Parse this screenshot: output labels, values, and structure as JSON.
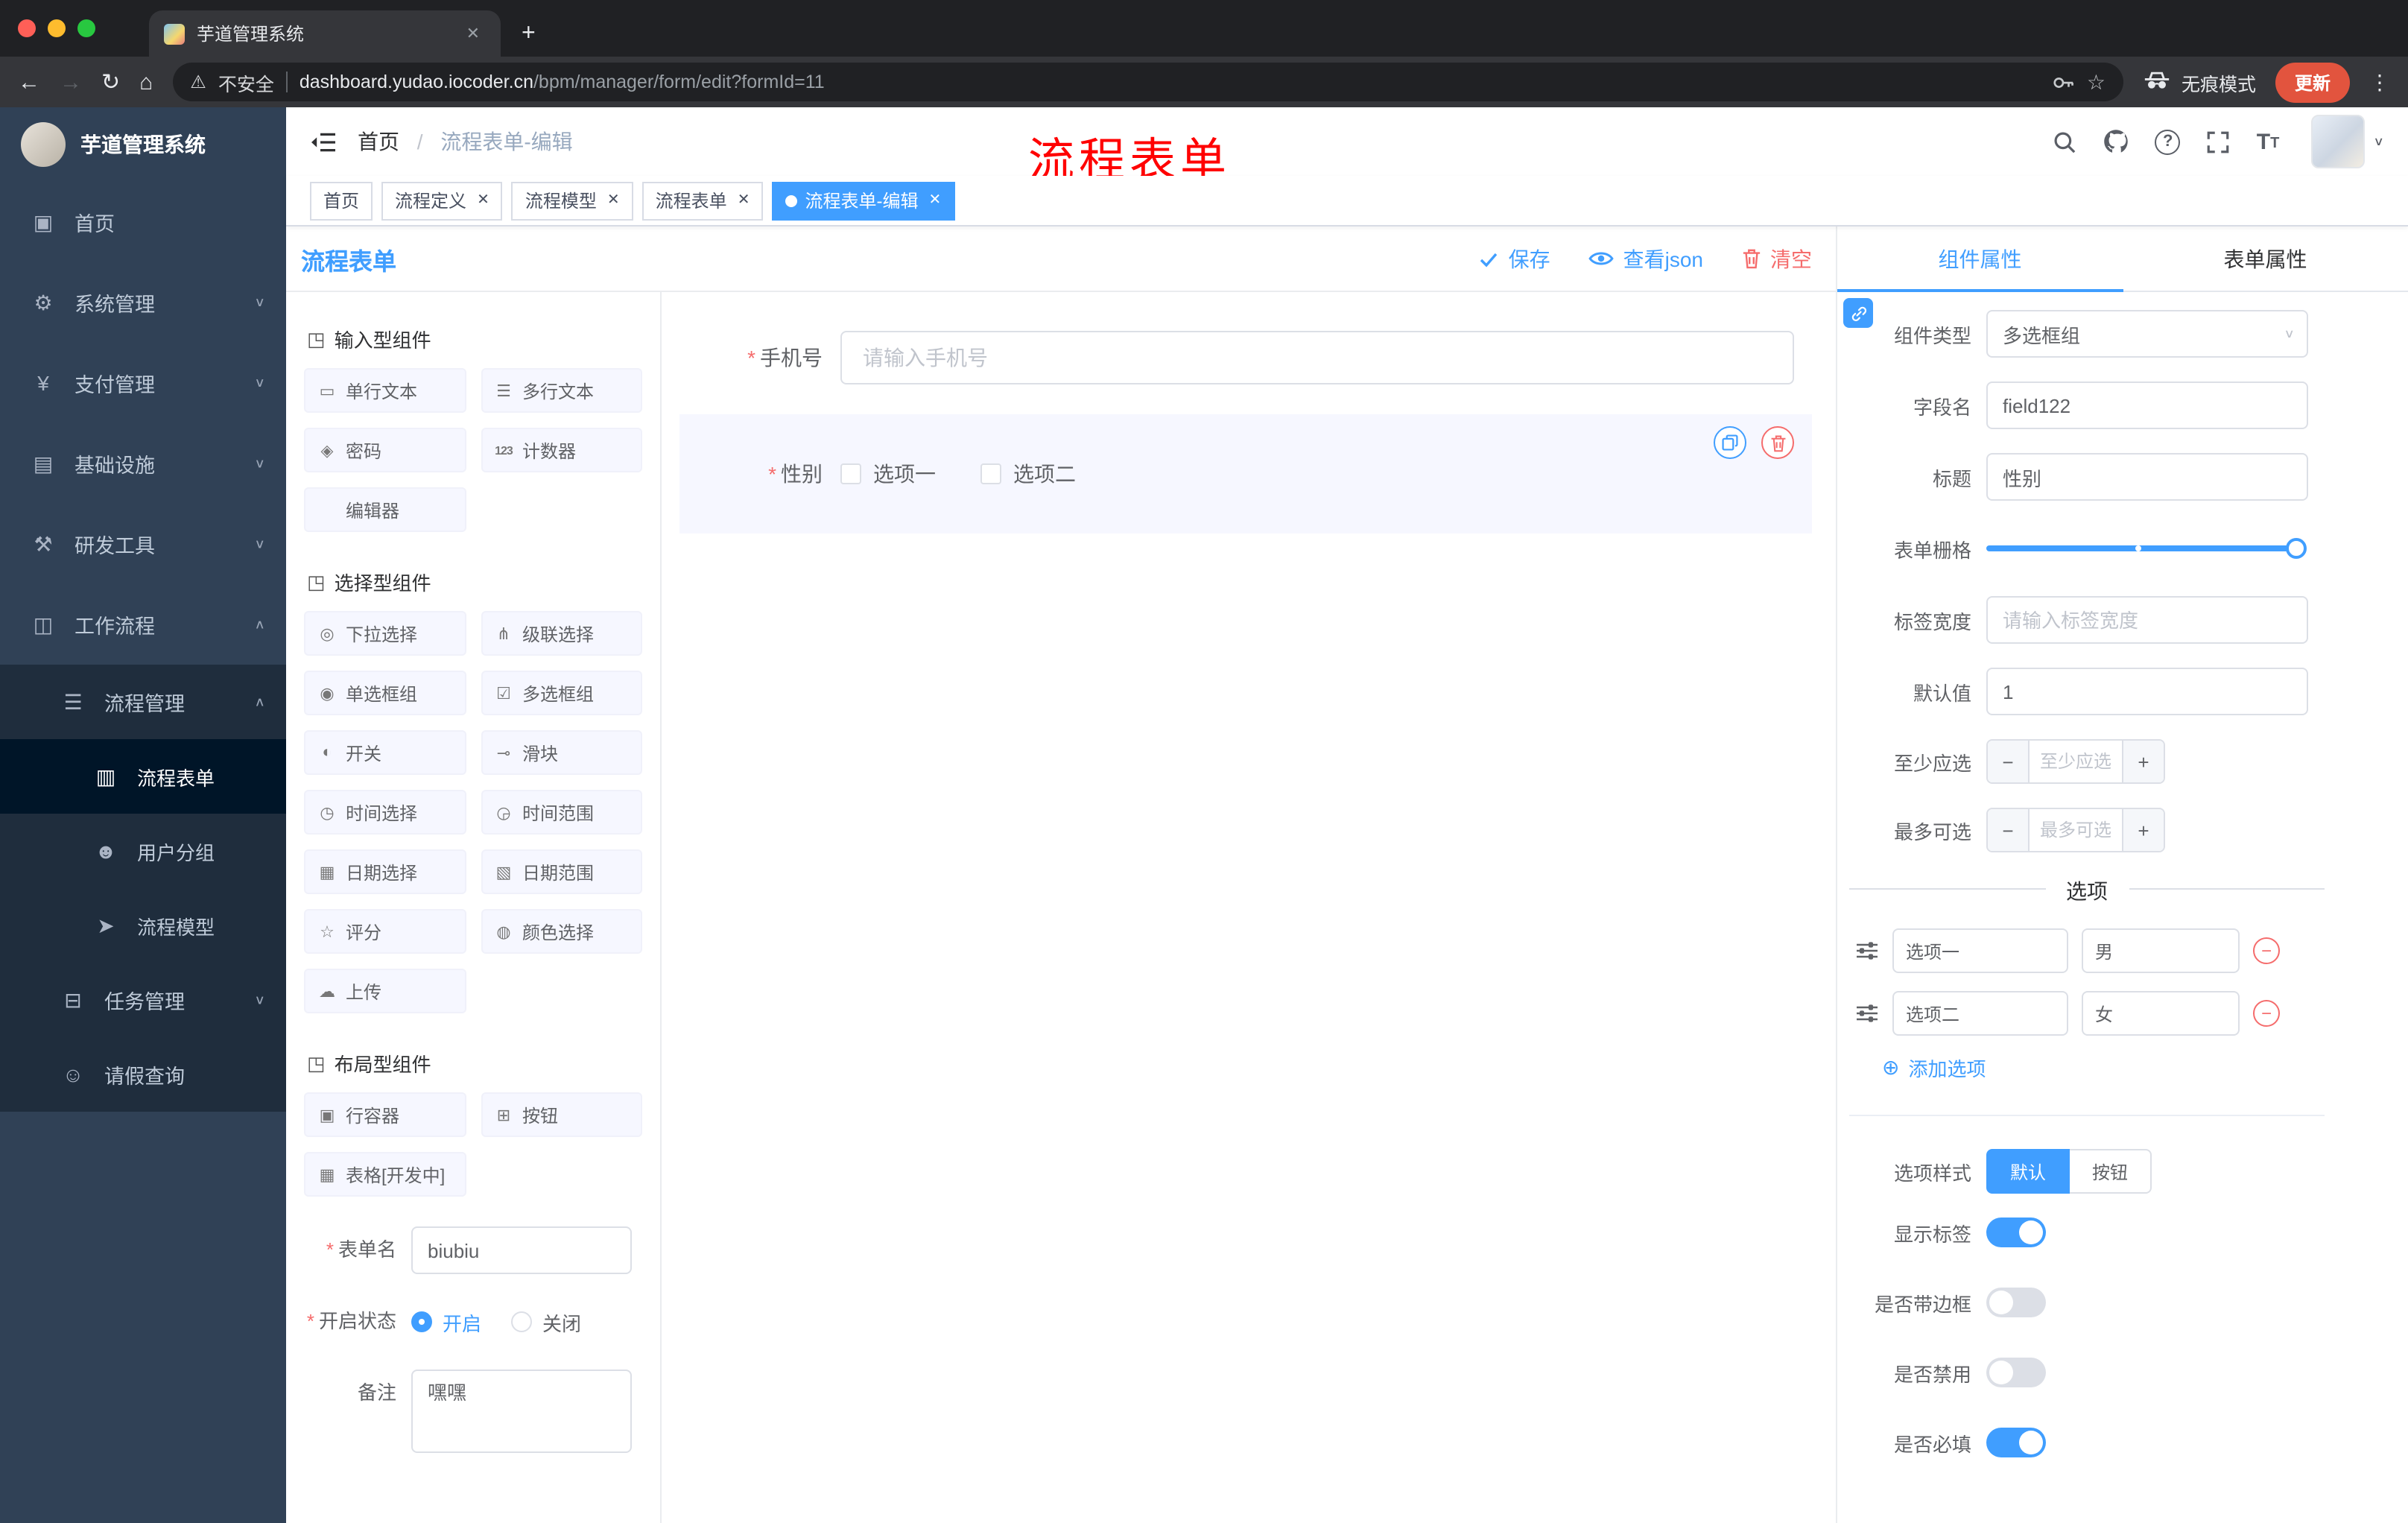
{
  "colors": {
    "accent": "#409eff",
    "danger": "#f56c6c",
    "annotation_red": "#ff0000",
    "sidebar_bg": "#304156"
  },
  "icons": {
    "required": "*",
    "chevron_down": "∨",
    "chevron_up": "∧",
    "caret_down": "∨",
    "close": "✕",
    "plus": "+",
    "minus": "−",
    "more": "⋮",
    "back": "←",
    "forward": "→",
    "reload": "↻",
    "home": "⌂",
    "warning": "⚠",
    "star": "☆",
    "add_circle": "⊕",
    "section": "◳",
    "question_mark": "?",
    "t_big": "T",
    "t_small": "T"
  },
  "browser": {
    "tab_title": "芋道管理系统",
    "security_label": "不安全",
    "url_host": "dashboard.yudao.iocoder.cn",
    "url_path": "/bpm/manager/form/edit?formId=11",
    "incognito_label": "无痕模式",
    "update_label": "更新"
  },
  "sidebar": {
    "logo_title": "芋道管理系统",
    "menu": [
      {
        "icon": "▣",
        "label": "首页"
      },
      {
        "icon": "⚙",
        "label": "系统管理"
      },
      {
        "icon": "¥",
        "label": "支付管理"
      },
      {
        "icon": "▤",
        "label": "基础设施"
      },
      {
        "icon": "⚒",
        "label": "研发工具"
      },
      {
        "icon": "◫",
        "label": "工作流程"
      },
      {
        "icon": "☰",
        "label": "流程管理"
      },
      {
        "icon": "▥",
        "label": "流程表单"
      },
      {
        "icon": "☻",
        "label": "用户分组"
      },
      {
        "icon": "➤",
        "label": "流程模型"
      },
      {
        "icon": "⊟",
        "label": "任务管理"
      },
      {
        "icon": "☺",
        "label": "请假查询"
      }
    ]
  },
  "header": {
    "breadcrumb_home": "首页",
    "breadcrumb_sep": "/",
    "breadcrumb_current": "流程表单-编辑",
    "annotation": "流程表单"
  },
  "tags": [
    {
      "label": "首页"
    },
    {
      "label": "流程定义"
    },
    {
      "label": "流程模型"
    },
    {
      "label": "流程表单"
    },
    {
      "label": "流程表单-编辑"
    }
  ],
  "designer": {
    "title": "流程表单",
    "save_label": "保存",
    "view_json_label": "查看json",
    "clear_label": "清空",
    "sections": [
      {
        "title": "输入型组件",
        "items": [
          {
            "icon": "▭",
            "label": "单行文本"
          },
          {
            "icon": "☰",
            "label": "多行文本"
          },
          {
            "icon": "◈",
            "label": "密码"
          },
          {
            "icon": "123",
            "label": "计数器"
          },
          {
            "icon": "",
            "label": "编辑器"
          }
        ]
      },
      {
        "title": "选择型组件",
        "items": [
          {
            "icon": "◎",
            "label": "下拉选择"
          },
          {
            "icon": "⋔",
            "label": "级联选择"
          },
          {
            "icon": "◉",
            "label": "单选框组"
          },
          {
            "icon": "☑",
            "label": "多选框组"
          },
          {
            "icon": "◐",
            "label": "开关"
          },
          {
            "icon": "⊸",
            "label": "滑块"
          },
          {
            "icon": "◷",
            "label": "时间选择"
          },
          {
            "icon": "◶",
            "label": "时间范围"
          },
          {
            "icon": "▦",
            "label": "日期选择"
          },
          {
            "icon": "▧",
            "label": "日期范围"
          },
          {
            "icon": "☆",
            "label": "评分"
          },
          {
            "icon": "◍",
            "label": "颜色选择"
          },
          {
            "icon": "☁",
            "label": "上传"
          }
        ]
      },
      {
        "title": "布局型组件",
        "items": [
          {
            "icon": "▣",
            "label": "行容器"
          },
          {
            "icon": "⊞",
            "label": "按钮"
          },
          {
            "icon": "▦",
            "label": "表格[开发中]"
          }
        ]
      }
    ],
    "meta": {
      "form_name_label": "表单名",
      "form_name_value": "biubiu",
      "status_label": "开启状态",
      "status_on": "开启",
      "status_off": "关闭",
      "remark_label": "备注",
      "remark_value": "嘿嘿"
    }
  },
  "canvas": {
    "phone_label": "手机号",
    "phone_placeholder": "请输入手机号",
    "gender_label": "性别",
    "gender_option1": "选项一",
    "gender_option2": "选项二"
  },
  "properties": {
    "tab_component": "组件属性",
    "tab_form": "表单属性",
    "component_type_label": "组件类型",
    "component_type_value": "多选框组",
    "field_name_label": "字段名",
    "field_name_value": "field122",
    "title_label": "标题",
    "title_value": "性别",
    "grid_label": "表单栅格",
    "label_width_label": "标签宽度",
    "label_width_placeholder": "请输入标签宽度",
    "default_label": "默认值",
    "default_value": "1",
    "min_label": "至少应选",
    "min_placeholder": "至少应选",
    "max_label": "最多可选",
    "max_placeholder": "最多可选",
    "options_divider": "选项",
    "options": [
      {
        "label": "选项一",
        "value": "男"
      },
      {
        "label": "选项二",
        "value": "女"
      }
    ],
    "add_option_label": "添加选项",
    "style_label": "选项样式",
    "style_default": "默认",
    "style_button": "按钮",
    "show_label_label": "显示标签",
    "border_label": "是否带边框",
    "disabled_label": "是否禁用",
    "required_label": "是否必填"
  }
}
